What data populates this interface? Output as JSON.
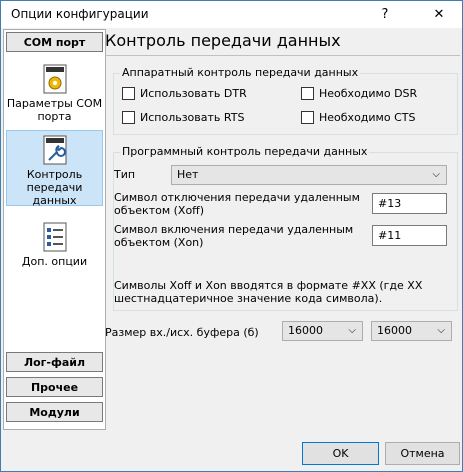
{
  "window": {
    "title": "Опции конфигурации",
    "help": "?",
    "close": "✕"
  },
  "sidebar": {
    "top_button": "COM порт",
    "items": [
      {
        "label": "Параметры COM порта",
        "icon": "settings-doc-icon"
      },
      {
        "label": "Контроль передачи данных",
        "icon": "wrench-doc-icon"
      },
      {
        "label": "Доп. опции",
        "icon": "options-list-icon"
      }
    ],
    "bottom_buttons": [
      "Лог-файл",
      "Прочее",
      "Модули"
    ]
  },
  "main": {
    "title": "Контроль передачи данных",
    "hardware": {
      "label": "Аппаратный контроль передачи данных",
      "use_dtr": "Использовать DTR",
      "use_rts": "Использовать RTS",
      "need_dsr": "Необходимо DSR",
      "need_cts": "Необходимо CTS"
    },
    "software": {
      "label": "Программный контроль передачи данных",
      "type_label": "Тип",
      "type_value": "Нет",
      "xoff_label": "Символ отключения передачи удаленным объектом (Xoff)",
      "xoff_value": "#13",
      "xon_label": "Символ включения передачи удаленным объектом (Xon)",
      "xon_value": "#11",
      "note": "Символы Xoff и Xon вводятся в формате #XX (где XX шестнадцатеричное значение кода символа)."
    },
    "buffer": {
      "label": "Размер вх./исх. буфера (б)",
      "in_value": "16000",
      "out_value": "16000"
    }
  },
  "footer": {
    "ok": "OK",
    "cancel": "Отмена"
  }
}
